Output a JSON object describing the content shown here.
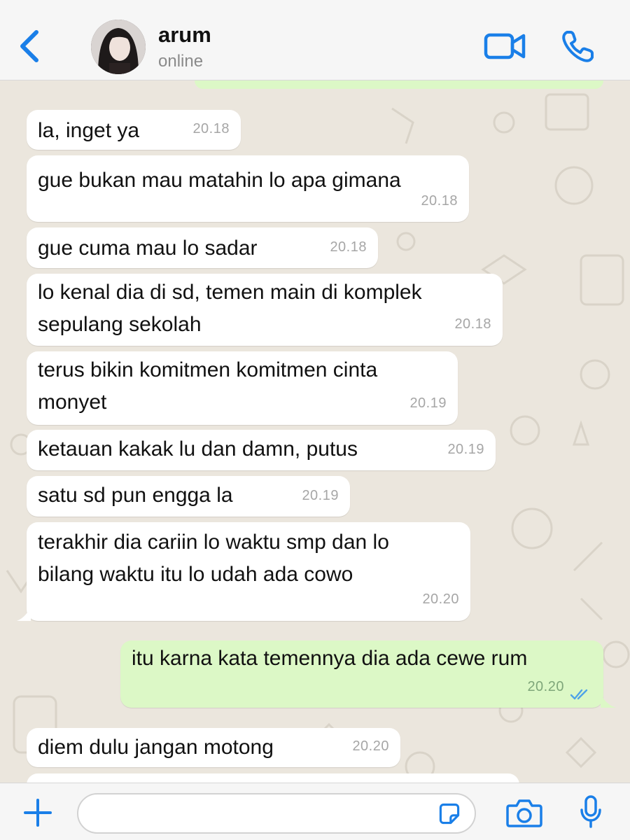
{
  "header": {
    "contact_name": "arum",
    "status": "online"
  },
  "colors": {
    "accent": "#1a7fe8",
    "incoming_bubble": "#ffffff",
    "outgoing_bubble": "#dcf8c6",
    "chat_bg": "#ebe6dd"
  },
  "icons": {
    "back": "chevron-left-icon",
    "video": "video-camera-icon",
    "call": "phone-icon",
    "attach": "plus-icon",
    "sticker": "sticker-icon",
    "camera": "camera-icon",
    "mic": "microphone-icon",
    "read_receipt": "double-check-icon"
  },
  "messages": [
    {
      "direction": "in",
      "text": "la, inget ya",
      "time": "20.18"
    },
    {
      "direction": "in",
      "text": "gue bukan mau matahin lo apa gimana",
      "time": "20.18"
    },
    {
      "direction": "in",
      "text": "gue cuma mau lo sadar",
      "time": "20.18"
    },
    {
      "direction": "in",
      "text": "lo kenal dia di sd, temen main di komplek\nsepulang sekolah",
      "time": "20.18"
    },
    {
      "direction": "in",
      "text": "terus bikin komitmen komitmen cinta\nmonyet",
      "time": "20.19"
    },
    {
      "direction": "in",
      "text": "ketauan kakak lu dan damn, putus",
      "time": "20.19"
    },
    {
      "direction": "in",
      "text": "satu sd pun engga la",
      "time": "20.19"
    },
    {
      "direction": "in",
      "text": "terakhir dia cariin lo waktu smp dan lo\nbilang waktu itu lo udah ada cowo",
      "time": "20.20"
    },
    {
      "direction": "out",
      "text": "itu karna kata temennya dia ada cewe rum",
      "time": "20.20",
      "read": true
    },
    {
      "direction": "in",
      "text": "diem dulu jangan motong",
      "time": "20.20"
    }
  ],
  "composer": {
    "input_value": ""
  }
}
